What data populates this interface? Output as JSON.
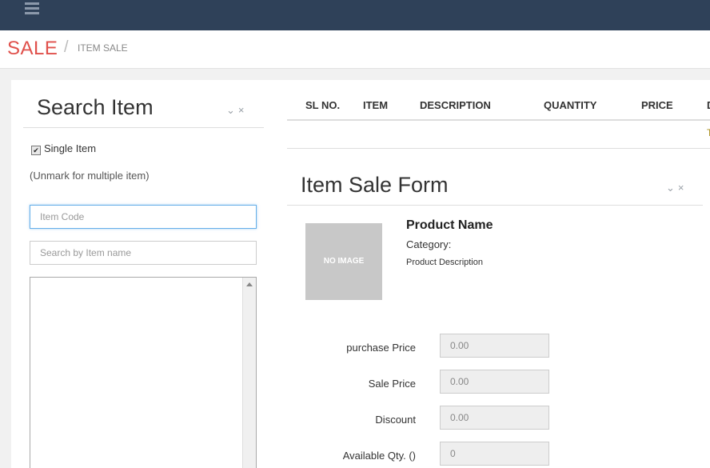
{
  "breadcrumb": {
    "title": "SALE",
    "separator": "/",
    "current": "ITEM SALE"
  },
  "search_panel": {
    "title": "Search Item",
    "tools": {
      "collapse": "⌄",
      "close": "×"
    },
    "single_item": {
      "label": "Single Item",
      "checked": true,
      "check_mark": "✔"
    },
    "hint": "(Unmark for multiple item)",
    "item_code": {
      "value": "",
      "placeholder": "Item Code"
    },
    "item_name": {
      "value": "",
      "placeholder": "Search by Item name"
    }
  },
  "sale_table": {
    "columns": [
      "SL NO.",
      "ITEM",
      "DESCRIPTION",
      "QUANTITY",
      "PRICE",
      "D"
    ],
    "total_fragment": "T"
  },
  "sale_form": {
    "title": "Item Sale Form",
    "tools": {
      "collapse": "⌄",
      "close": "×"
    },
    "product": {
      "image_text": "NO IMAGE",
      "name": "Product Name",
      "category_label": "Category:",
      "description": "Product Description"
    },
    "fields": [
      {
        "label": "purchase Price",
        "value": "0.00"
      },
      {
        "label": "Sale Price",
        "value": "0.00"
      },
      {
        "label": "Discount",
        "value": "0.00"
      },
      {
        "label": "Available Qty. ()",
        "value": "0"
      }
    ]
  },
  "colors": {
    "topbar": "#2f4159",
    "accent_red": "#e0504b",
    "focus_blue": "#66afe9",
    "total_gold": "#a88d1a"
  },
  "icons": {
    "menu": "hamburger-icon",
    "collapse": "chevron-down-icon",
    "close": "close-icon",
    "scroll": "scroll-up-arrow-icon"
  }
}
